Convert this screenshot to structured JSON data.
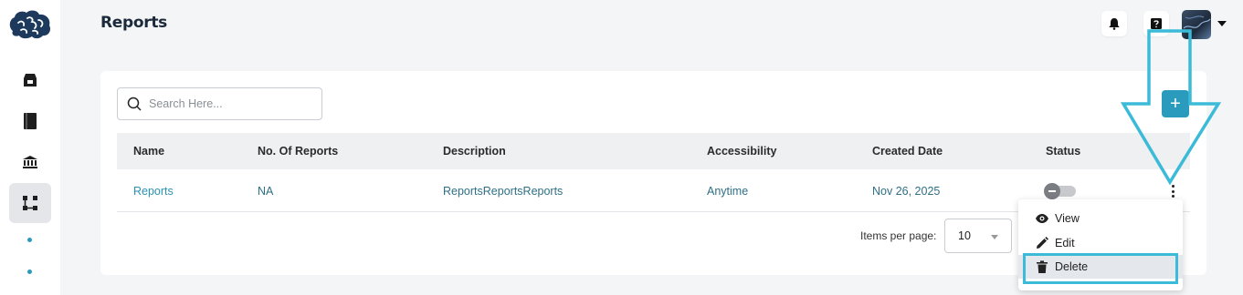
{
  "header": {
    "title": "Reports",
    "notification_icon": "bell-icon",
    "help_icon": "help-icon"
  },
  "sidebar": {
    "items": [
      {
        "icon": "archive-icon"
      },
      {
        "icon": "book-icon"
      },
      {
        "icon": "bank-icon"
      },
      {
        "icon": "workflow-icon",
        "active": true
      }
    ]
  },
  "search": {
    "placeholder": "Search Here..."
  },
  "add_button": {
    "label": "+"
  },
  "table": {
    "columns": [
      "Name",
      "No. Of Reports",
      "Description",
      "Accessibility",
      "Created Date",
      "Status"
    ],
    "rows": [
      {
        "name": "Reports",
        "count": "NA",
        "description": "ReportsReportsReports",
        "accessibility": "Anytime",
        "created": "Nov 26, 2025",
        "status_on": false
      }
    ]
  },
  "pagination": {
    "items_per_page_label": "Items per page:",
    "items_per_page_value": "10"
  },
  "action_menu": {
    "items": [
      {
        "label": "View",
        "icon": "eye-icon"
      },
      {
        "label": "Edit",
        "icon": "pencil-icon"
      },
      {
        "label": "Delete",
        "icon": "trash-icon",
        "highlighted": true
      }
    ]
  },
  "colors": {
    "accent": "#2a9bbd",
    "annotation": "#3bbbd8",
    "title": "#1b2a3a"
  }
}
